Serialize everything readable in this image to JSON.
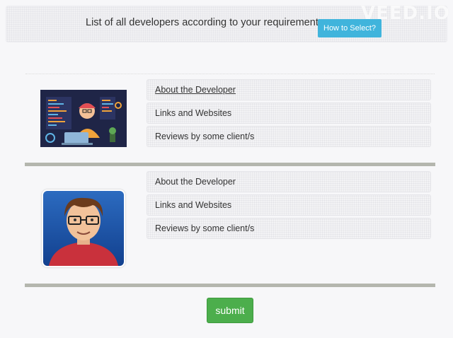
{
  "header": {
    "title": "List of all developers according to your requirements.",
    "how_button": "How to Select?",
    "watermark": "VEED.IO"
  },
  "developers": [
    {
      "image_icon": "developer-at-laptop-illustration",
      "sections": [
        {
          "label": "About the Developer"
        },
        {
          "label": "Links and Websites"
        },
        {
          "label": "Reviews by some client/s"
        }
      ]
    },
    {
      "image_icon": "developer-avatar-portrait",
      "sections": [
        {
          "label": "About the Developer"
        },
        {
          "label": "Links and Websites"
        },
        {
          "label": "Reviews by some client/s"
        }
      ]
    }
  ],
  "footer": {
    "submit_label": "submit"
  },
  "colors": {
    "accent_blue": "#40b4dc",
    "submit_green": "#4cae4c",
    "divider": "#b4b6ae"
  }
}
